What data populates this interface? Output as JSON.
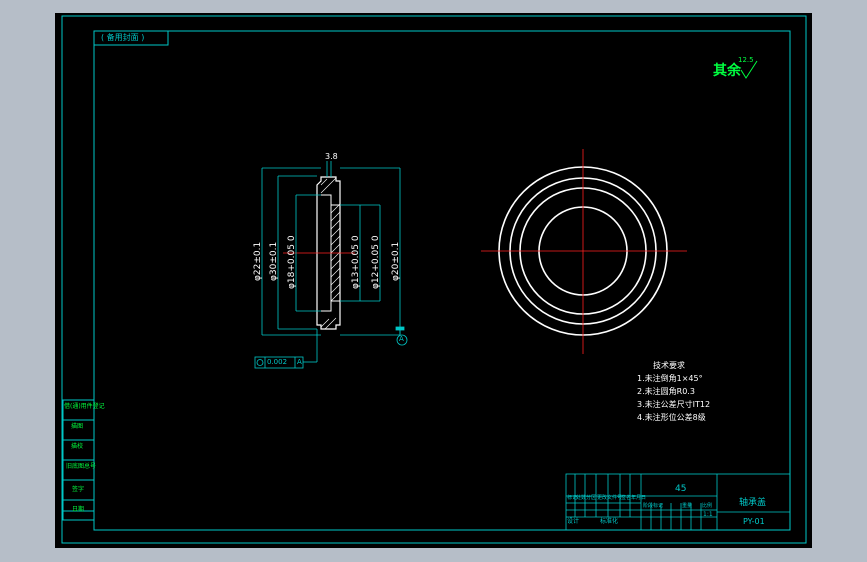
{
  "drawing": {
    "top_label": "( 备用封面 )",
    "roughness": {
      "text": "其余",
      "value": "12.5"
    },
    "section_view": {
      "top_dim": "3.8",
      "dims": [
        "φ22±0.1",
        "φ30±0.1",
        "φ18+0.05 0",
        "φ13+0.05 0",
        "φ12+0.05 0",
        "φ20±0.1"
      ],
      "datum": "A",
      "tolerance_frame": {
        "value": "0.002",
        "datum": "A"
      }
    },
    "technical_notes": {
      "title": "技术要求",
      "items": [
        "1.未注倒角1×45°",
        "2.未注圆角R0.3",
        "3.未注公差尺寸IT12",
        "4.未注形位公差8级"
      ]
    },
    "side_table": [
      "借(通)用件登记",
      "描图",
      "描校",
      "旧底图总号",
      "签字",
      "日期"
    ],
    "title_block": {
      "material": "45",
      "part_name": "轴承盖",
      "drawing_no": "PY-01",
      "scale": "1:1",
      "row_headers": [
        "标记",
        "处数",
        "分区",
        "更改文件号",
        "签名",
        "年月日"
      ],
      "bottom_labels": [
        "设计",
        "标准化",
        "阶段标记",
        "重量",
        "比例"
      ]
    }
  },
  "colors": {
    "border": "#00c8c8",
    "geometry": "#ffffff",
    "centerline": "#ff2020",
    "roughness": "#00ff40"
  }
}
